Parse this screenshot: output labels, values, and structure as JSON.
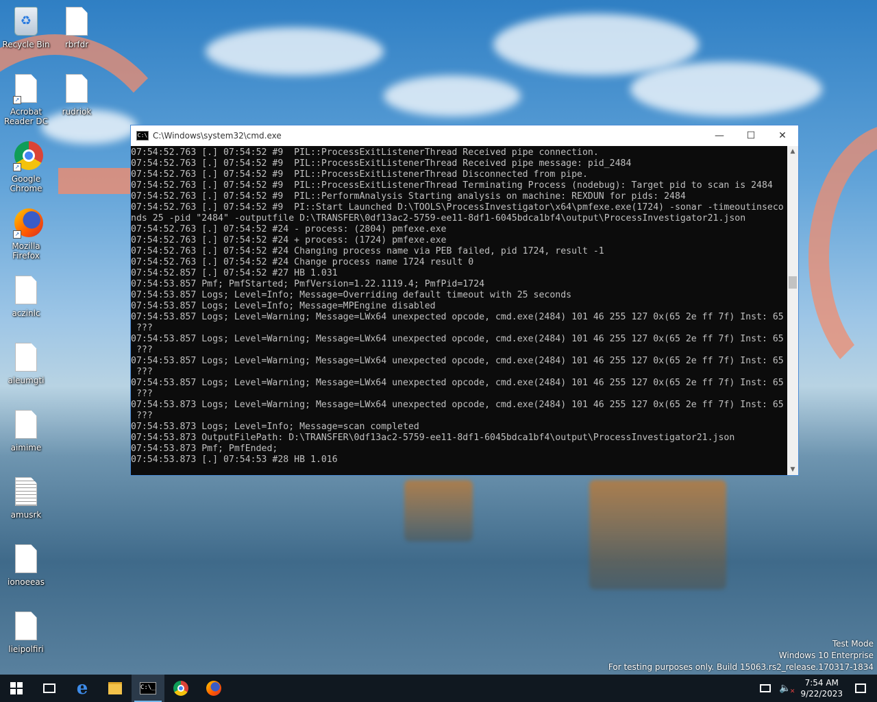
{
  "desktop": {
    "icons": [
      {
        "label": "Recycle Bin"
      },
      {
        "label": "rbrfdr"
      },
      {
        "label": "Acrobat Reader DC"
      },
      {
        "label": "rudriok"
      },
      {
        "label": "Google Chrome"
      },
      {
        "label": "Mozilla Firefox"
      },
      {
        "label": "aczinlc"
      },
      {
        "label": "aleumgti"
      },
      {
        "label": "aimime"
      },
      {
        "label": "amusrk"
      },
      {
        "label": "ionoeeas"
      },
      {
        "label": "lieipolfiri"
      }
    ]
  },
  "cmd_window": {
    "title": "C:\\Windows\\system32\\cmd.exe",
    "minimize_glyph": "—",
    "maximize_glyph": "☐",
    "close_glyph": "✕",
    "icon_text": "C:\\",
    "lines": [
      "07:54:52.763 [.] 07:54:52 #9  PIL::ProcessExitListenerThread Received pipe connection.",
      "07:54:52.763 [.] 07:54:52 #9  PIL::ProcessExitListenerThread Received pipe message: pid_2484",
      "07:54:52.763 [.] 07:54:52 #9  PIL::ProcessExitListenerThread Disconnected from pipe.",
      "07:54:52.763 [.] 07:54:52 #9  PIL::ProcessExitListenerThread Terminating Process (nodebug): Target pid to scan is 2484",
      "07:54:52.763 [.] 07:54:52 #9  PIL::PerformAnalysis Starting analysis on machine: REXDUN for pids: 2484",
      "07:54:52.763 [.] 07:54:52 #9  PI::Start Launched D:\\TOOLS\\ProcessInvestigator\\x64\\pmfexe.exe(1724) -sonar -timeoutinseco",
      "nds 25 -pid \"2484\" -outputfile D:\\TRANSFER\\0df13ac2-5759-ee11-8df1-6045bdca1bf4\\output\\ProcessInvestigator21.json",
      "07:54:52.763 [.] 07:54:52 #24 - process: (2804) pmfexe.exe",
      "07:54:52.763 [.] 07:54:52 #24 + process: (1724) pmfexe.exe",
      "07:54:52.763 [.] 07:54:52 #24 Changing process name via PEB failed, pid 1724, result -1",
      "07:54:52.763 [.] 07:54:52 #24 Change process name 1724 result 0",
      "07:54:52.857 [.] 07:54:52 #27 HB 1.031",
      "07:54:53.857 Pmf; PmfStarted; PmfVersion=1.22.1119.4; PmfPid=1724",
      "07:54:53.857 Logs; Level=Info; Message=Overriding default timeout with 25 seconds",
      "07:54:53.857 Logs; Level=Info; Message=MPEngine disabled",
      "07:54:53.857 Logs; Level=Warning; Message=LWx64 unexpected opcode, cmd.exe(2484) 101 46 255 127 0x(65 2e ff 7f) Inst: 65",
      " ???",
      "07:54:53.857 Logs; Level=Warning; Message=LWx64 unexpected opcode, cmd.exe(2484) 101 46 255 127 0x(65 2e ff 7f) Inst: 65",
      " ???",
      "07:54:53.857 Logs; Level=Warning; Message=LWx64 unexpected opcode, cmd.exe(2484) 101 46 255 127 0x(65 2e ff 7f) Inst: 65",
      " ???",
      "07:54:53.857 Logs; Level=Warning; Message=LWx64 unexpected opcode, cmd.exe(2484) 101 46 255 127 0x(65 2e ff 7f) Inst: 65",
      " ???",
      "07:54:53.873 Logs; Level=Warning; Message=LWx64 unexpected opcode, cmd.exe(2484) 101 46 255 127 0x(65 2e ff 7f) Inst: 65",
      " ???",
      "07:54:53.873 Logs; Level=Info; Message=scan completed",
      "07:54:53.873 OutputFilePath: D:\\TRANSFER\\0df13ac2-5759-ee11-8df1-6045bdca1bf4\\output\\ProcessInvestigator21.json",
      "07:54:53.873 Pmf; PmfEnded;",
      "07:54:53.873 [.] 07:54:53 #28 HB 1.016"
    ]
  },
  "watermark": {
    "line1": "Test Mode",
    "line2": "Windows 10 Enterprise",
    "line3": "For testing purposes only. Build 15063.rs2_release.170317-1834"
  },
  "taskbar": {
    "cmd_icon_text": "C:\\_",
    "clock_time": "7:54 AM",
    "clock_date": "9/22/2023"
  },
  "colors": {
    "console_bg": "#0c0c0c",
    "console_text": "#c0c0c0",
    "taskbar_bg": "#101820",
    "window_border": "#4a8ad4"
  }
}
